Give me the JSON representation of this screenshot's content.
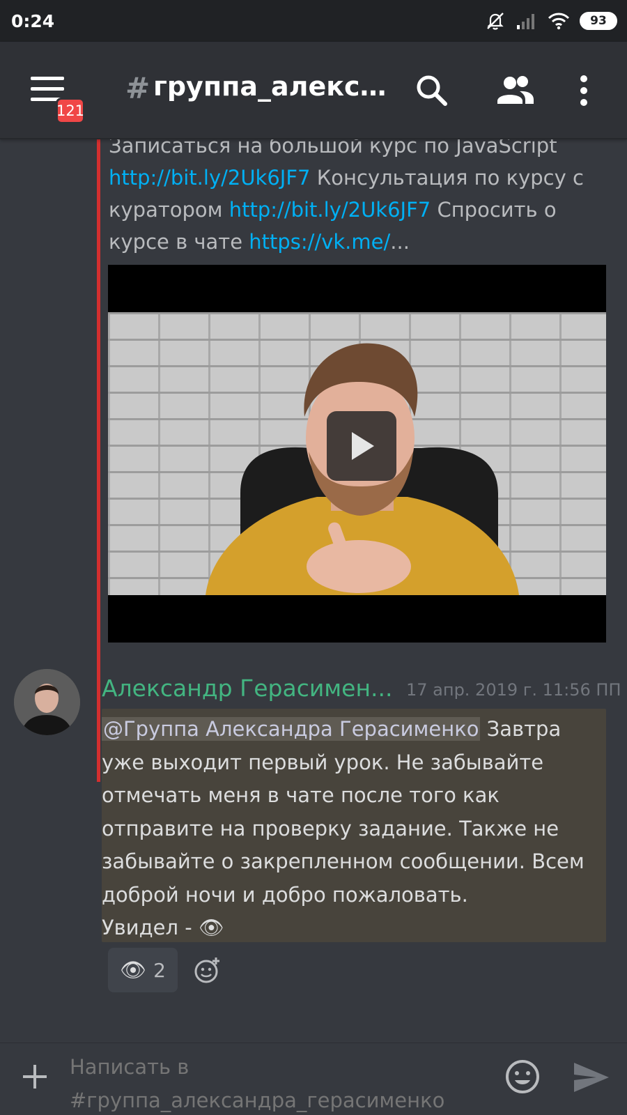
{
  "status_bar": {
    "time": "0:24",
    "battery": "93",
    "icons": [
      "bell-off-icon",
      "signal-icon",
      "wifi-icon",
      "battery-icon"
    ]
  },
  "header": {
    "menu_icon": "hamburger-icon",
    "unread_badge": "121",
    "hash": "#",
    "channel_name": "группа_алекса...",
    "icons": [
      "search-icon",
      "members-icon",
      "more-vertical-icon"
    ]
  },
  "embed": {
    "description_top": "Записаться на большой курс по JavaScript",
    "link1": "http://bit.ly/2Uk6JF7",
    "text1": " Консультация по курсу с куратором ",
    "link2": "http://bit.ly/2Uk6JF7",
    "text2": " Спросить о курсе в чате ",
    "link3": "https://vk.me/",
    "ellipsis": "...",
    "video_play_icon": "play-icon",
    "accent_color": "#d32f2f"
  },
  "message": {
    "author": "Александр Герасимен...",
    "author_color": "#43b581",
    "timestamp": "17 апр. 2019 г. 11:56 ПП",
    "mention": "@Группа Александра Герасименко",
    "body": " Завтра уже выходит первый урок. Не забывайте отмечать меня в чате после того как отправите на проверку задание. Также не забывайте о закрепленном сообщении. Всем доброй ночи и добро пожаловать.",
    "last_line": "Увидел - 👁",
    "reaction": {
      "emoji": "👁",
      "count": "2"
    },
    "add_reaction_icon": "add-reaction-icon"
  },
  "input": {
    "placeholder": "Написать в #группа_александра_герасименко",
    "plus_icon": "plus-icon",
    "emoji_icon": "emoji-icon",
    "send_icon": "send-icon"
  }
}
